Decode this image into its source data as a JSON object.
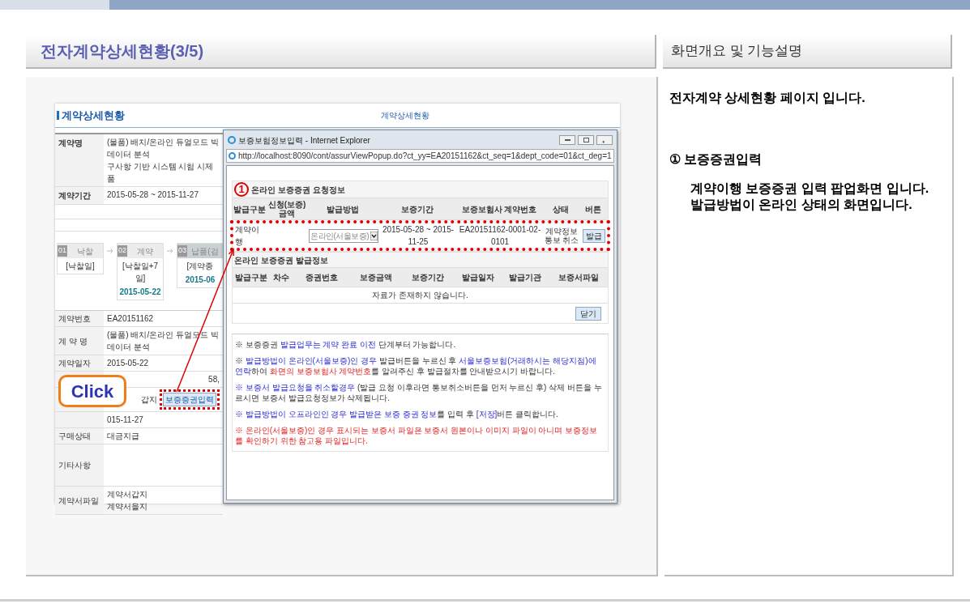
{
  "slide": {
    "title": "전자계약상세현황(3/5)",
    "side_title": "화면개요 및 기능설명"
  },
  "description": {
    "intro": "전자계약 상세현황 페이지 입니다.",
    "items": [
      {
        "marker": "①",
        "title": "보증증권입력",
        "lines": [
          "계약이행 보증증권 입력 팝업화면 입니다.",
          "발급방법이 온라인 상태의 화면입니다."
        ]
      }
    ]
  },
  "page": {
    "heading": "계약상세현황",
    "crumb": "계약상세현황",
    "top_rows": [
      {
        "label": "계약명",
        "lines": [
          "(물품) 배치/온라인 듀얼모드 빅데이터 분석",
          "구사항 기반 시스템 시험 시제품"
        ]
      },
      {
        "label": "계약기간",
        "lines": [
          "2015-05-28 ~ 2015-11-27"
        ]
      }
    ],
    "steps": [
      {
        "number": "01",
        "title": "낙찰",
        "when": "[낙찰일]",
        "selected": false
      },
      {
        "number": "02",
        "title": "계약",
        "when": "[낙찰일+7일]",
        "date": "2015-05-22",
        "selected": false
      },
      {
        "number": "03",
        "title": "납품(검",
        "when": "[계약종",
        "date": "2015-06",
        "selected": true
      }
    ],
    "rows": [
      {
        "kind": "text",
        "label": "계약번호",
        "value": "EA20151162"
      },
      {
        "kind": "text",
        "label": "계 약 명",
        "value": "(물품) 배치/온라인 듀얼모드 빅데이터 분석"
      },
      {
        "kind": "text",
        "label": "계약일자",
        "value": "2015-05-22"
      },
      {
        "kind": "amount",
        "value": "58,"
      },
      {
        "kind": "action",
        "value": "갑지",
        "button": "보증증권입력"
      },
      {
        "kind": "text",
        "value": "015-11-27"
      },
      {
        "kind": "text",
        "label": "구매상태",
        "value": "대금지급"
      },
      {
        "kind": "blank",
        "label": "기타사항"
      },
      {
        "kind": "files",
        "label": "계약서파일",
        "files": [
          "계약서갑지",
          "계약서을지"
        ]
      }
    ]
  },
  "callout": {
    "text": "Click"
  },
  "popup": {
    "title": "보증보험정보입력 - Internet Explorer",
    "address": "http://localhost:8090/cont/assurViewPopup.do?ct_yy=EA20151162&ct_seq=1&dept_code=01&ct_deg=1",
    "request": {
      "marker": "1",
      "title": "온라인 보증증권 요청정보",
      "columns": [
        "발급구분",
        "신청(보증)금액",
        "발급방법",
        "보증기간",
        "보증보험사 계약번호",
        "상태",
        "버튼"
      ],
      "row": {
        "type": "계약이행",
        "method": "온라인(서울보증)",
        "period": "2015-05-28 ~ 2015-11-25",
        "contract_no": "EA20151162-0001-02-0101",
        "status": "계약정보통보 취소",
        "button": "발급"
      }
    },
    "issued": {
      "title": "온라인 보증증권 발급정보",
      "columns": [
        "발급구분",
        "차수",
        "증권번호",
        "보증금액",
        "보증기간",
        "발급일자",
        "발급기관",
        "보증서파일"
      ],
      "empty": "자료가 존재하지 않습니다.",
      "close": "닫기"
    },
    "notes": [
      [
        {
          "kind": "plain",
          "text": "※ 보증증권 "
        },
        {
          "kind": "emphasis",
          "text": "발급업무는 계약 완료 이전"
        },
        {
          "kind": "plain",
          "text": " 단계부터 가능합니다."
        }
      ],
      [
        {
          "kind": "plain",
          "text": "※ "
        },
        {
          "kind": "emphasis",
          "text": "발급방법이 온라인(서울보증)인 경우"
        },
        {
          "kind": "plain",
          "text": " 발급버튼을 누르신 후 "
        },
        {
          "kind": "emphasis",
          "text": "서울보증보험(거래하시는 해당지점)에 연락"
        },
        {
          "kind": "plain",
          "text": "하여 "
        },
        {
          "kind": "warning",
          "text": "화면의 보증보험사 계약번호"
        },
        {
          "kind": "plain",
          "text": "를 알려주신 후 발급절차를 안내받으시기 바랍니다."
        }
      ],
      [
        {
          "kind": "emphasis",
          "text": "※ 보증서 발급요청을 취소할경우"
        },
        {
          "kind": "plain",
          "text": " (발급 요청 이후라면 통보취소버튼을 먼저 누르신 후) 삭제 버튼을 누르시면 보증서 발급요청정보가 삭제됩니다."
        }
      ],
      [
        {
          "kind": "emphasis",
          "text": "※ 발급방법이 오프라인인 경우 발급받은 보증 증권 정보"
        },
        {
          "kind": "plain",
          "text": "를 입력 후 "
        },
        {
          "kind": "emphasis",
          "text": "[저장]"
        },
        {
          "kind": "plain",
          "text": "버튼 클릭합니다."
        }
      ],
      [
        {
          "kind": "warning",
          "text": "※ 온라인(서울보증)인 경우 표시되는 보증서 파일은 보증서 원본이나 이미지 파일이 아니며 보증정보를 확인하기 위한 참고용 파일입니다."
        }
      ]
    ]
  }
}
